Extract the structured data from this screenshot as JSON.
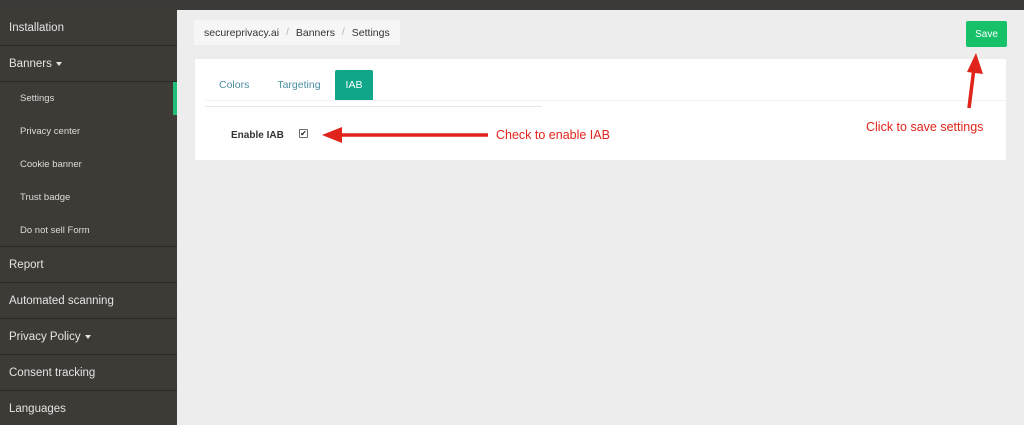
{
  "sidebar": {
    "items": [
      {
        "label": "Installation"
      },
      {
        "label": "Banners"
      },
      {
        "label": "Settings"
      },
      {
        "label": "Privacy center"
      },
      {
        "label": "Cookie banner"
      },
      {
        "label": "Trust badge"
      },
      {
        "label": "Do not sell Form"
      },
      {
        "label": "Report"
      },
      {
        "label": "Automated scanning"
      },
      {
        "label": "Privacy Policy"
      },
      {
        "label": "Consent tracking"
      },
      {
        "label": "Languages"
      }
    ],
    "active_item": "Settings"
  },
  "breadcrumb": {
    "items": [
      "secureprivacy.ai",
      "Banners",
      "Settings"
    ],
    "separator": "/"
  },
  "toolbar": {
    "save_label": "Save"
  },
  "tabs": [
    {
      "label": "Colors"
    },
    {
      "label": "Targeting"
    },
    {
      "label": "IAB"
    }
  ],
  "active_tab": "IAB",
  "iab": {
    "label": "Enable IAB",
    "checked": true,
    "check_glyph": "✔"
  },
  "annotations": {
    "check_text": "Check to enable IAB",
    "save_text": "Click to save settings",
    "color": "#e0241b"
  },
  "colors": {
    "sidebar_bg": "#3e3b37",
    "accent_green": "#17c16a",
    "tab_active": "#10a68a",
    "annotation_red": "#e0241b"
  }
}
